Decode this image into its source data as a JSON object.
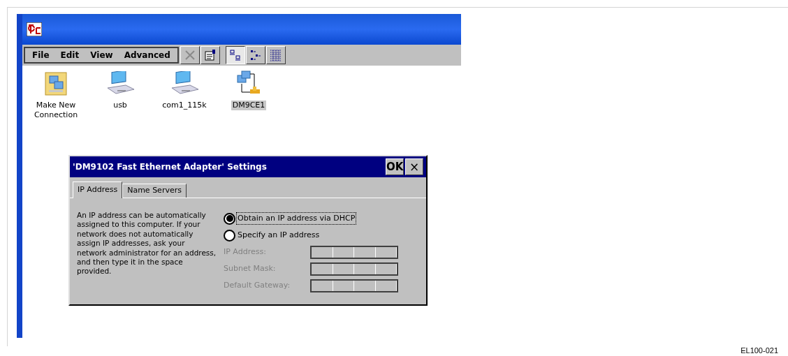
{
  "menu": [
    {
      "label": "File"
    },
    {
      "label": "Edit"
    },
    {
      "label": "View"
    },
    {
      "label": "Advanced"
    }
  ],
  "toolbar": [
    {
      "kind": "delete",
      "disabled": true,
      "selected": false
    },
    {
      "kind": "properties",
      "disabled": false,
      "selected": false
    },
    {
      "kind": "large-icons",
      "disabled": false,
      "selected": true
    },
    {
      "kind": "small-icons",
      "disabled": false,
      "selected": false
    },
    {
      "kind": "details",
      "disabled": false,
      "selected": false
    }
  ],
  "connections": [
    {
      "kind": "wizard",
      "label": "Make New Connection",
      "selected": false
    },
    {
      "kind": "direct",
      "label": "usb",
      "selected": false
    },
    {
      "kind": "direct",
      "label": "com1_115k",
      "selected": false
    },
    {
      "kind": "lan",
      "label": "DM9CE1",
      "selected": true
    }
  ],
  "dialog": {
    "title": "'DM9102 Fast Ethernet Adapter' Settings",
    "ok": "OK",
    "close": "×",
    "tabs": [
      {
        "label": "IP Address",
        "selected": true
      },
      {
        "label": "Name Servers",
        "selected": false
      }
    ],
    "description": "An IP address can be automatically assigned to this computer.  If your network does not automatically assign IP addresses, ask your network administrator for an address, and then type it in the space provided.",
    "options": [
      {
        "label": "Obtain an IP address via DHCP",
        "selected": true
      },
      {
        "label": "Specify an IP address",
        "selected": false
      }
    ],
    "fields": [
      {
        "label": "IP Address:",
        "disabled": true
      },
      {
        "label": "Subnet Mask:",
        "disabled": true
      },
      {
        "label": "Default Gateway:",
        "disabled": true
      }
    ]
  },
  "figure_id": "EL100-021"
}
